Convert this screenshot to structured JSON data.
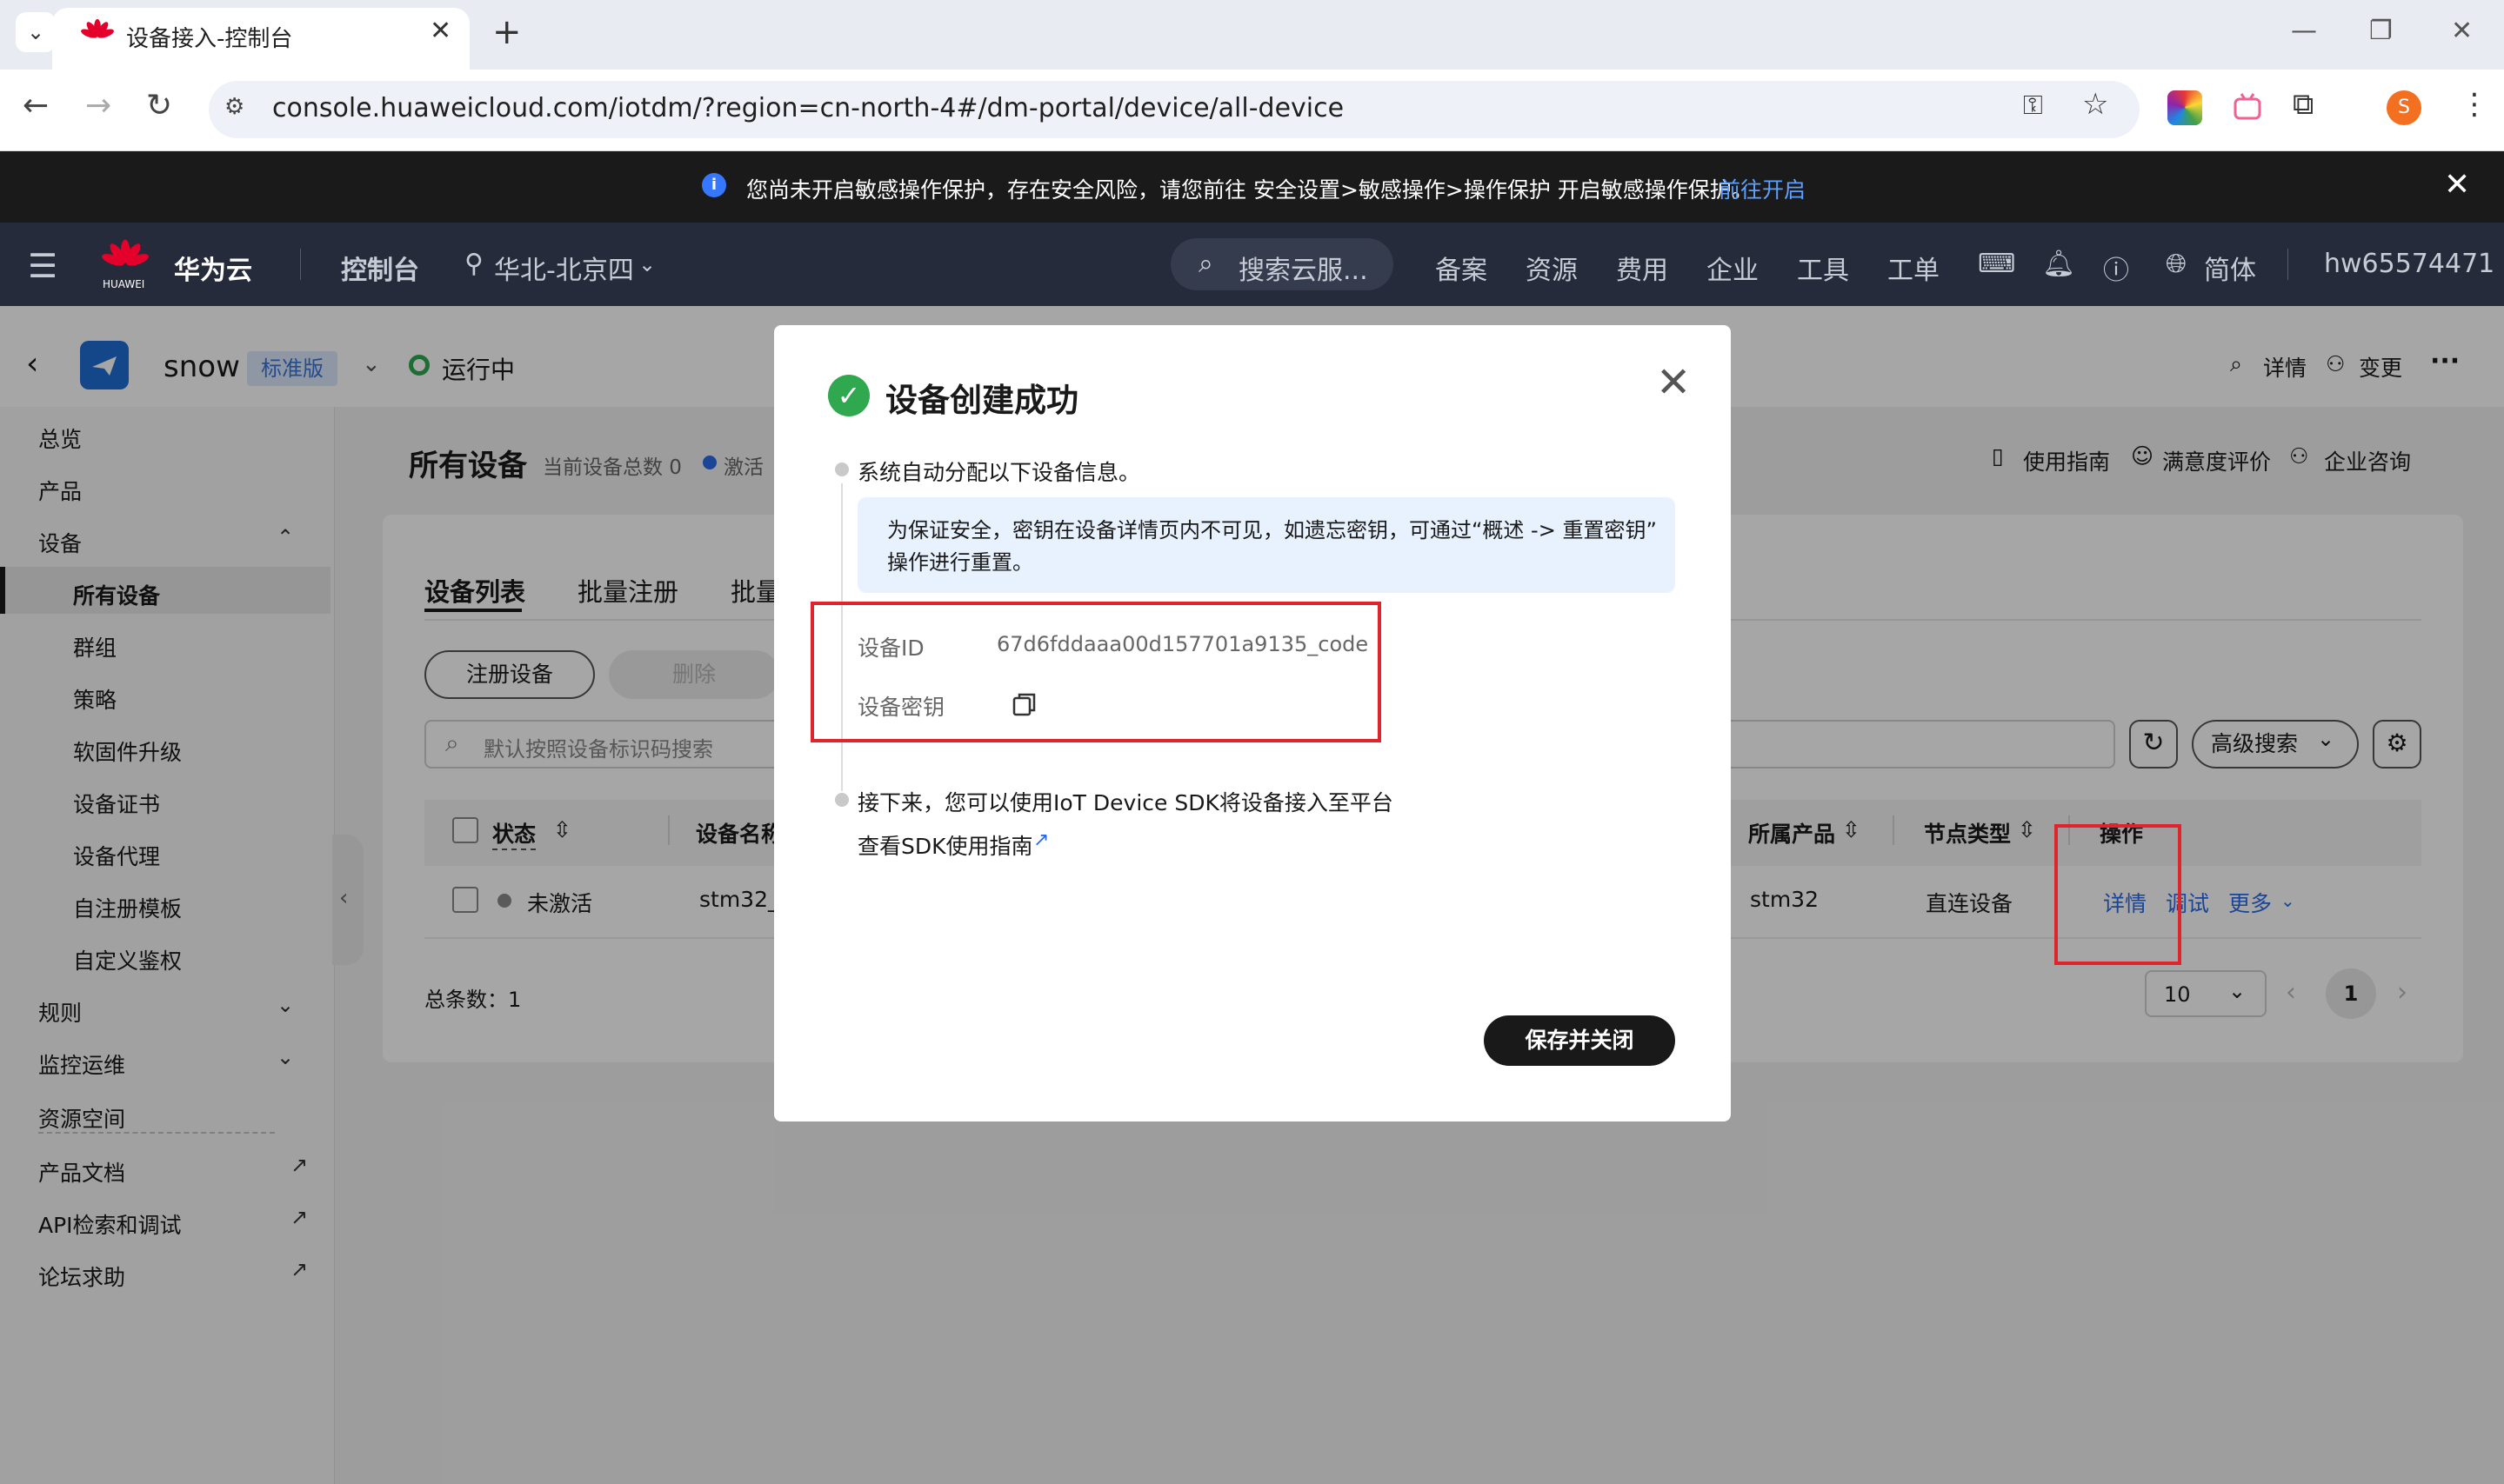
{
  "browser": {
    "tab_title": "设备接入-控制台",
    "tab_favicon_label": "HUAWEI",
    "url": "console.huaweicloud.com/iotdm/?region=cn-north-4#/dm-portal/device/all-device",
    "profile_initial": "S"
  },
  "warning_bar": {
    "text": "您尚未开启敏感操作保护，存在安全风险，请您前往 安全设置>敏感操作>操作保护 开启敏感操作保护。",
    "link": "前往开启"
  },
  "topnav": {
    "logo_text": "华为云",
    "logo_sub": "HUAWEI",
    "console": "控制台",
    "region": "华北-北京四",
    "search_placeholder": "搜索云服...",
    "items": [
      "备案",
      "资源",
      "费用",
      "企业",
      "工具",
      "工单"
    ],
    "language": "简体",
    "username": "hw65574471"
  },
  "instance": {
    "name": "snow",
    "edition": "标准版",
    "status": "运行中",
    "detail": "详情",
    "change": "变更",
    "more": "···"
  },
  "sidebar": {
    "overview": "总览",
    "product": "产品",
    "device": "设备",
    "device_children": [
      "所有设备",
      "群组",
      "策略",
      "软固件升级",
      "设备证书",
      "设备代理",
      "自注册模板",
      "自定义鉴权"
    ],
    "rules": "规则",
    "monitoring": "监控运维",
    "resource_space": "资源空间",
    "product_docs": "产品文档",
    "api_explorer": "API检索和调试",
    "forum": "论坛求助"
  },
  "main": {
    "title": "所有设备",
    "device_count": "当前设备总数 0",
    "activated_partial": "激活",
    "guide": "使用指南",
    "rating": "满意度评价",
    "consult": "企业咨询",
    "tabs": [
      "设备列表",
      "批量注册",
      "批量"
    ],
    "register_button": "注册设备",
    "delete_button": "删除",
    "search_placeholder": "默认按照设备标识码搜索",
    "advanced_search": "高级搜索",
    "columns": {
      "status": "状态",
      "device_name": "设备名称",
      "product": "所属产品",
      "node_type": "节点类型",
      "actions": "操作"
    },
    "row": {
      "status": "未激活",
      "device_name": "stm32_(",
      "product": "stm32",
      "node_type": "直连设备",
      "action_detail": "详情",
      "action_debug": "调试",
      "action_more": "更多"
    },
    "total": "总条数：1",
    "page_size": "10",
    "current_page": "1"
  },
  "modal": {
    "title": "设备创建成功",
    "step1": "系统自动分配以下设备信息。",
    "notice_line1": "为保证安全，密钥在设备详情页内不可见，如遗忘密钥，可通过“概述 -> 重置密钥”",
    "notice_line2": "操作进行重置。",
    "device_id_label": "设备ID",
    "device_id_value": "67d6fddaaa00d157701a9135_code",
    "device_secret_label": "设备密钥",
    "step2": "接下来，您可以使用IoT Device SDK将设备接入至平台",
    "sdk_link": "查看SDK使用指南",
    "save_close": "保存并关闭"
  },
  "colors": {
    "accent_blue": "#2a6ae9",
    "success_green": "#2fa84f",
    "annotation_red": "#e0242d",
    "nav_dark": "#252b3a"
  }
}
